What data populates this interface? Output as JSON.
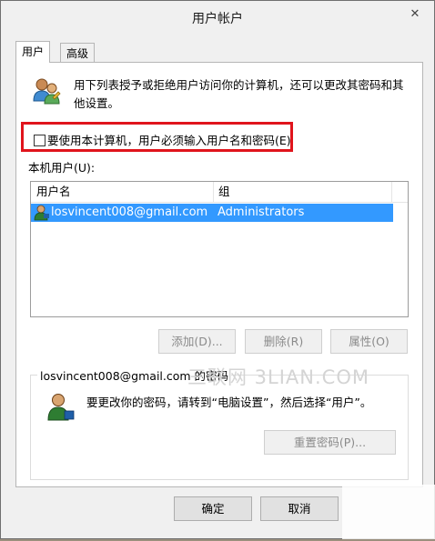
{
  "window": {
    "title": "用户帐户",
    "close_glyph": "✕"
  },
  "tabs": [
    {
      "label": "用户",
      "active": true
    },
    {
      "label": "高级",
      "active": false
    }
  ],
  "description": "用下列表授予或拒绝用户访问你的计算机，还可以更改其密码和其他设置。",
  "require_login": {
    "label": "要使用本计算机，用户必须输入用户名和密码(E)",
    "checked": false
  },
  "users_list": {
    "label": "本机用户(U):",
    "columns": [
      "用户名",
      "组"
    ],
    "rows": [
      {
        "name": "losvincent008@gmail.com",
        "group": "Administrators",
        "selected": true
      }
    ]
  },
  "list_buttons": {
    "add": "添加(D)...",
    "remove": "删除(R)",
    "properties": "属性(O)"
  },
  "password_group": {
    "title": "losvincent008@gmail.com 的密码",
    "text": "要更改你的密码，请转到“电脑设置”，然后选择“用户”。",
    "reset_button": "重置密码(P)..."
  },
  "footer": {
    "ok": "确定",
    "cancel": "取消"
  },
  "watermark": "三联网 3LIAN.COM",
  "colors": {
    "selection": "#3399ff",
    "highlight_box": "#e0141c"
  },
  "icons": [
    "users-icon",
    "user-icon",
    "user-key-icon"
  ]
}
